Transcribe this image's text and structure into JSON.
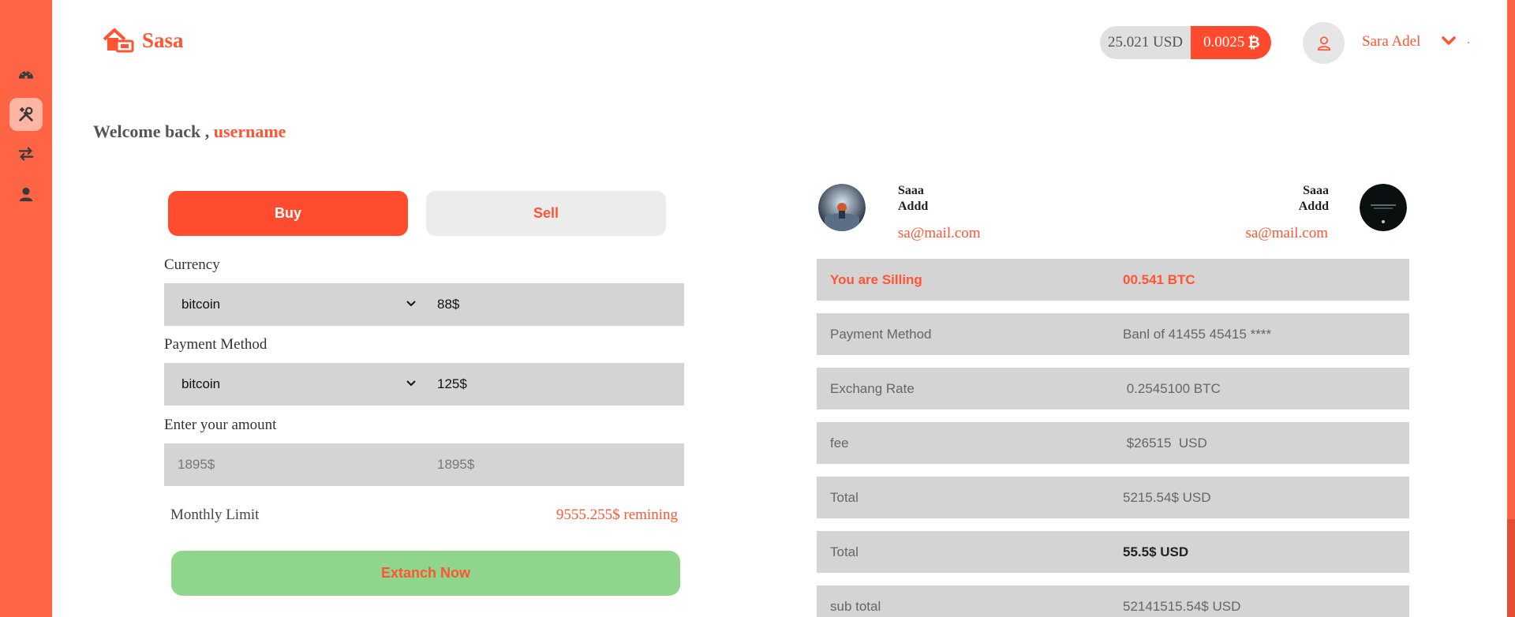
{
  "app": {
    "brand": "Sasa",
    "accent_color": "#ff5533"
  },
  "sidebar": {
    "items": [
      {
        "icon": "dashboard-icon",
        "active": false
      },
      {
        "icon": "tools-icon",
        "active": true
      },
      {
        "icon": "exchange-arrows-icon",
        "active": false
      },
      {
        "icon": "user-icon",
        "active": false
      }
    ]
  },
  "header": {
    "balance_usd": "25.021 USD",
    "balance_btc": "0.0025",
    "btc_symbol": "₿",
    "user_name": "Sara Adel"
  },
  "welcome": {
    "prefix": "Welcome back ,",
    "username": "username"
  },
  "trade": {
    "buy_label": "Buy",
    "sell_label": "Sell",
    "active_tab": "Buy",
    "currency_label": "Currency",
    "currency_value": "bitcoin",
    "currency_amount": "88$",
    "payment_label": "Payment Method",
    "payment_value": "bitcoin",
    "payment_amount": "125$",
    "amount_label": "Enter your amount",
    "amount_placeholder": "1895$",
    "amount_placeholder_2": "1895$",
    "limit_label": "Monthly Limit",
    "limit_value": "9555.255$ remining",
    "exchange_button": "Extanch Now"
  },
  "parties": {
    "left": {
      "name_line1": "Saaa",
      "name_line2": "Addd",
      "email": "sa@mail.com"
    },
    "right": {
      "name_line1": "Saaa",
      "name_line2": "Addd",
      "email": "sa@mail.com"
    }
  },
  "summary": [
    {
      "label": "You are Silling",
      "value": "00.541 BTC",
      "style": "highlight"
    },
    {
      "label": "Payment Method",
      "value": "Banl of 41455 45415 ****",
      "style": "normal"
    },
    {
      "label": "Exchang Rate",
      "value": " 0.2545100 BTC",
      "style": "normal"
    },
    {
      "label": "fee",
      "value": " $26515  USD",
      "style": "normal"
    },
    {
      "label": "Total",
      "value": "5215.54$ USD",
      "style": "normal"
    },
    {
      "label": "Total",
      "value": "55.5$ USD",
      "style": "bold"
    },
    {
      "label": "sub total",
      "value": "52141515.54$ USD",
      "style": "normal"
    }
  ]
}
